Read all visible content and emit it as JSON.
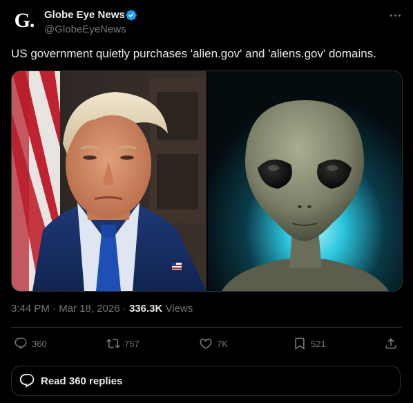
{
  "author": {
    "avatar_letter": "G.",
    "display_name": "Globe Eye News",
    "handle": "@GlobeEyeNews",
    "verified": true
  },
  "tweet": {
    "text": "US government quietly purchases 'alien.gov' and 'aliens.gov' domains."
  },
  "media": {
    "left_image": "portrait of man in blue suit with flag background",
    "right_image": "grey alien face on teal glowing background"
  },
  "meta": {
    "time": "3:44 PM",
    "separator": "·",
    "date": "Mar 18, 2026",
    "views_count": "336.3K",
    "views_label": "Views"
  },
  "actions": {
    "replies": "360",
    "reposts": "757",
    "likes": "7K",
    "bookmarks": "521"
  },
  "read_replies_label": "Read 360 replies",
  "colors": {
    "background": "#000000",
    "text": "#e7e9ea",
    "secondary_text": "#71767b",
    "border": "#2f3336",
    "verified": "#1d9bf0"
  }
}
